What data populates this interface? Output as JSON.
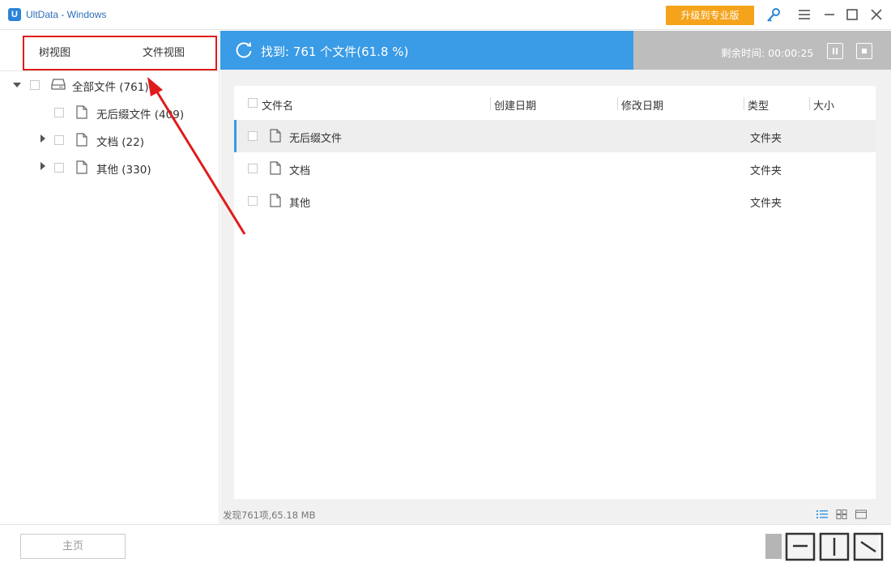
{
  "titlebar": {
    "logo_letter": "U",
    "app_title": "UltData - Windows",
    "upgrade_label": "升级到专业版"
  },
  "left_panel": {
    "tabs": [
      {
        "label": "树视图"
      },
      {
        "label": "文件视图"
      }
    ],
    "tree": {
      "root": {
        "label": "全部文件 (761)"
      },
      "children": [
        {
          "label": "无后缀文件 (409)"
        },
        {
          "label": "文档 (22)"
        },
        {
          "label": "其他 (330)"
        }
      ]
    }
  },
  "banner": {
    "status": "找到: 761 个文件(61.8 %)",
    "remaining": "剩余时间: 00:00:25"
  },
  "table": {
    "headers": {
      "name": "文件名",
      "created": "创建日期",
      "modified": "修改日期",
      "type": "类型",
      "size": "大小"
    },
    "rows": [
      {
        "name": "无后缀文件",
        "type": "文件夹"
      },
      {
        "name": "文档",
        "type": "文件夹"
      },
      {
        "name": "其他",
        "type": "文件夹"
      }
    ]
  },
  "footer": {
    "found_summary": "发现761项,65.18 MB"
  },
  "bottom": {
    "home_label": "主页"
  },
  "colors": {
    "accent_blue": "#3a9be6",
    "upgrade_orange": "#f5a31a",
    "annotation_red": "#e01b1b"
  }
}
